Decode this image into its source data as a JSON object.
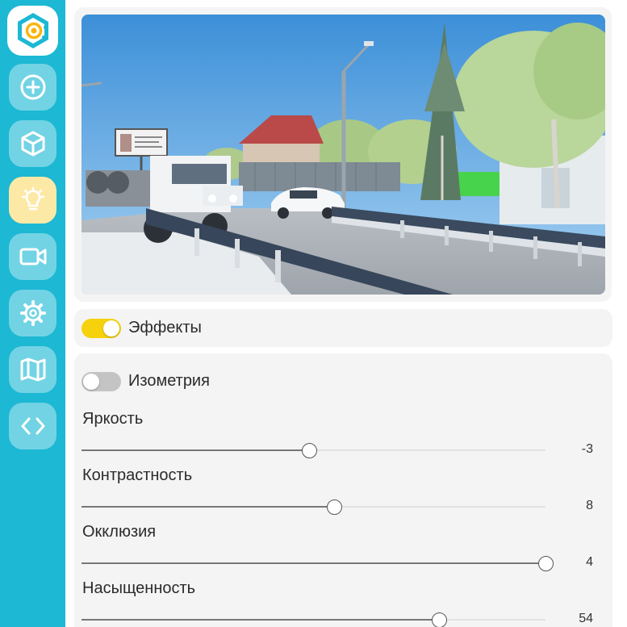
{
  "sidebar": {
    "items": [
      {
        "icon": "plus-circle-icon"
      },
      {
        "icon": "cube-icon"
      },
      {
        "icon": "lightbulb-icon",
        "active": true
      },
      {
        "icon": "video-camera-icon"
      },
      {
        "icon": "gear-icon"
      },
      {
        "icon": "map-icon"
      },
      {
        "icon": "code-icon"
      }
    ]
  },
  "preview": {
    "billboard_text": ""
  },
  "effects": {
    "label": "Эффекты",
    "enabled": true
  },
  "settings": {
    "isometry": {
      "label": "Изометрия",
      "enabled": false
    },
    "sliders": [
      {
        "label": "Яркость",
        "value": "-3",
        "fraction": 0.49
      },
      {
        "label": "Контрастность",
        "value": "8",
        "fraction": 0.545
      },
      {
        "label": "Окклюзия",
        "value": "4",
        "fraction": 1.0
      },
      {
        "label": "Насыщенность",
        "value": "54",
        "fraction": 0.77
      }
    ]
  },
  "colors": {
    "sidebar": "#1cb8d4",
    "active_nav": "#fde9a6",
    "toggle_on": "#f5d20c",
    "toggle_off": "#c4c4c4"
  }
}
